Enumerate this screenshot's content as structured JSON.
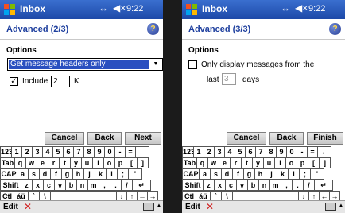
{
  "titlebar": {
    "title": "Inbox",
    "time": "9:22",
    "net_icon": "↔",
    "volume_icon": "◀×"
  },
  "screen1": {
    "header": "Advanced (2/3)",
    "options_label": "Options",
    "dropdown_value": "Get message headers only",
    "include_checked": true,
    "include_label": "Include",
    "include_value": "2",
    "include_unit": "K",
    "buttons": {
      "cancel": "Cancel",
      "back": "Back",
      "next": "Next"
    }
  },
  "screen2": {
    "header": "Advanced (3/3)",
    "options_label": "Options",
    "only_display_checked": false,
    "only_display_label": "Only display messages from the",
    "last_label": "last",
    "last_value": "3",
    "days_label": "days",
    "buttons": {
      "cancel": "Cancel",
      "back": "Back",
      "finish": "Finish"
    }
  },
  "keyboard": {
    "row1": [
      "123",
      "1",
      "2",
      "3",
      "4",
      "5",
      "6",
      "7",
      "8",
      "9",
      "0",
      "-",
      "=",
      "←"
    ],
    "row2": [
      "Tab",
      "q",
      "w",
      "e",
      "r",
      "t",
      "y",
      "u",
      "i",
      "o",
      "p",
      "[",
      "]"
    ],
    "row3": [
      "CAP",
      "a",
      "s",
      "d",
      "f",
      "g",
      "h",
      "j",
      "k",
      "l",
      ";",
      "'"
    ],
    "row4": [
      "Shift",
      "z",
      "x",
      "c",
      "v",
      "b",
      "n",
      "m",
      ",",
      ".",
      "/",
      "↵"
    ],
    "row5": [
      "Ctl",
      "áü",
      "`",
      "\\",
      "",
      "↓",
      "↑",
      "←",
      "→"
    ]
  },
  "menubar": {
    "edit_label": "Edit",
    "close_icon": "✕",
    "keyboard_icon": "keyboard-icon",
    "up_icon": "▲"
  },
  "help_icon": "?",
  "colors": {
    "titlebar": "#1d49a8",
    "header_text": "#1e3f9e",
    "selection": "#2a4fc0"
  }
}
